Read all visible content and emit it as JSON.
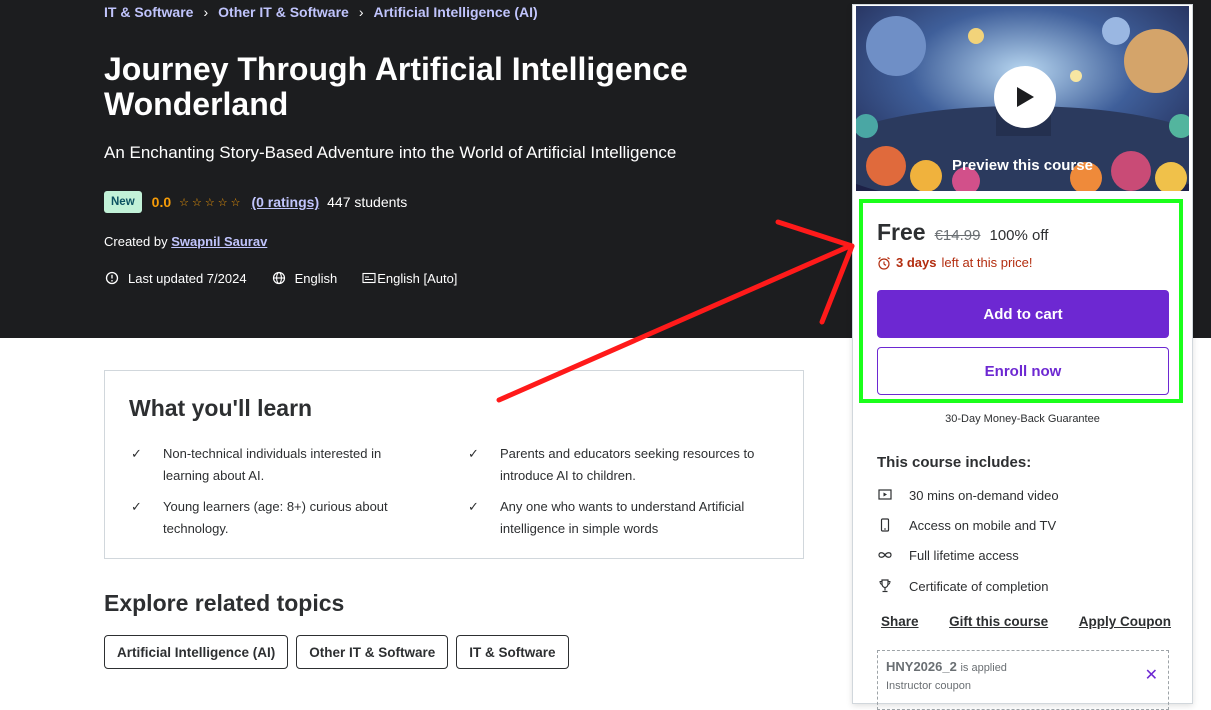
{
  "breadcrumb": [
    "IT & Software",
    "Other IT & Software",
    "Artificial Intelligence (AI)"
  ],
  "course": {
    "title": "Journey Through Artificial Intelligence Wonderland",
    "subtitle": "An Enchanting Story-Based Adventure into the World of Artificial Intelligence",
    "badge": "New",
    "rating": "0.0",
    "stars": "☆☆☆☆☆",
    "ratings_count": "(0 ratings)",
    "students": "447 students",
    "created_by_label": "Created by",
    "instructor": "Swapnil Saurav",
    "last_updated": "Last updated 7/2024",
    "language": "English",
    "captions": "English [Auto]"
  },
  "learn": {
    "title": "What you'll learn",
    "items": [
      "Non-technical individuals interested in learning about AI.",
      "Parents and educators seeking resources to introduce AI to children.",
      "Young learners (age: 8+) curious about technology.",
      "Any one who wants to understand Artificial intelligence in simple words"
    ]
  },
  "explore": {
    "title": "Explore related topics",
    "topics": [
      "Artificial Intelligence (AI)",
      "Other IT & Software",
      "IT & Software"
    ]
  },
  "sidebar": {
    "preview_label": "Preview this course",
    "price": "Free",
    "original_price": "€14.99",
    "discount": "100% off",
    "timer_bold": "3 days",
    "timer_rest": "left at this price!",
    "add_to_cart": "Add to cart",
    "enroll_now": "Enroll now",
    "guarantee": "30-Day Money-Back Guarantee",
    "includes_title": "This course includes:",
    "includes": [
      {
        "icon": "video-icon",
        "label": "30 mins on-demand video"
      },
      {
        "icon": "mobile-icon",
        "label": "Access on mobile and TV"
      },
      {
        "icon": "infinity-icon",
        "label": "Full lifetime access"
      },
      {
        "icon": "trophy-icon",
        "label": "Certificate of completion"
      }
    ],
    "share": "Share",
    "gift": "Gift this course",
    "apply_coupon": "Apply Coupon",
    "coupon_code": "HNY2026_2",
    "coupon_applied": "is applied",
    "coupon_sub": "Instructor coupon"
  },
  "colors": {
    "hero_bg": "#1c1d1f",
    "accent_purple": "#6d28d2",
    "link_lavender": "#c0c4fc",
    "rating_orange": "#f69c08",
    "highlight_green": "#1bff1b",
    "arrow_red": "#ff1a1a"
  }
}
